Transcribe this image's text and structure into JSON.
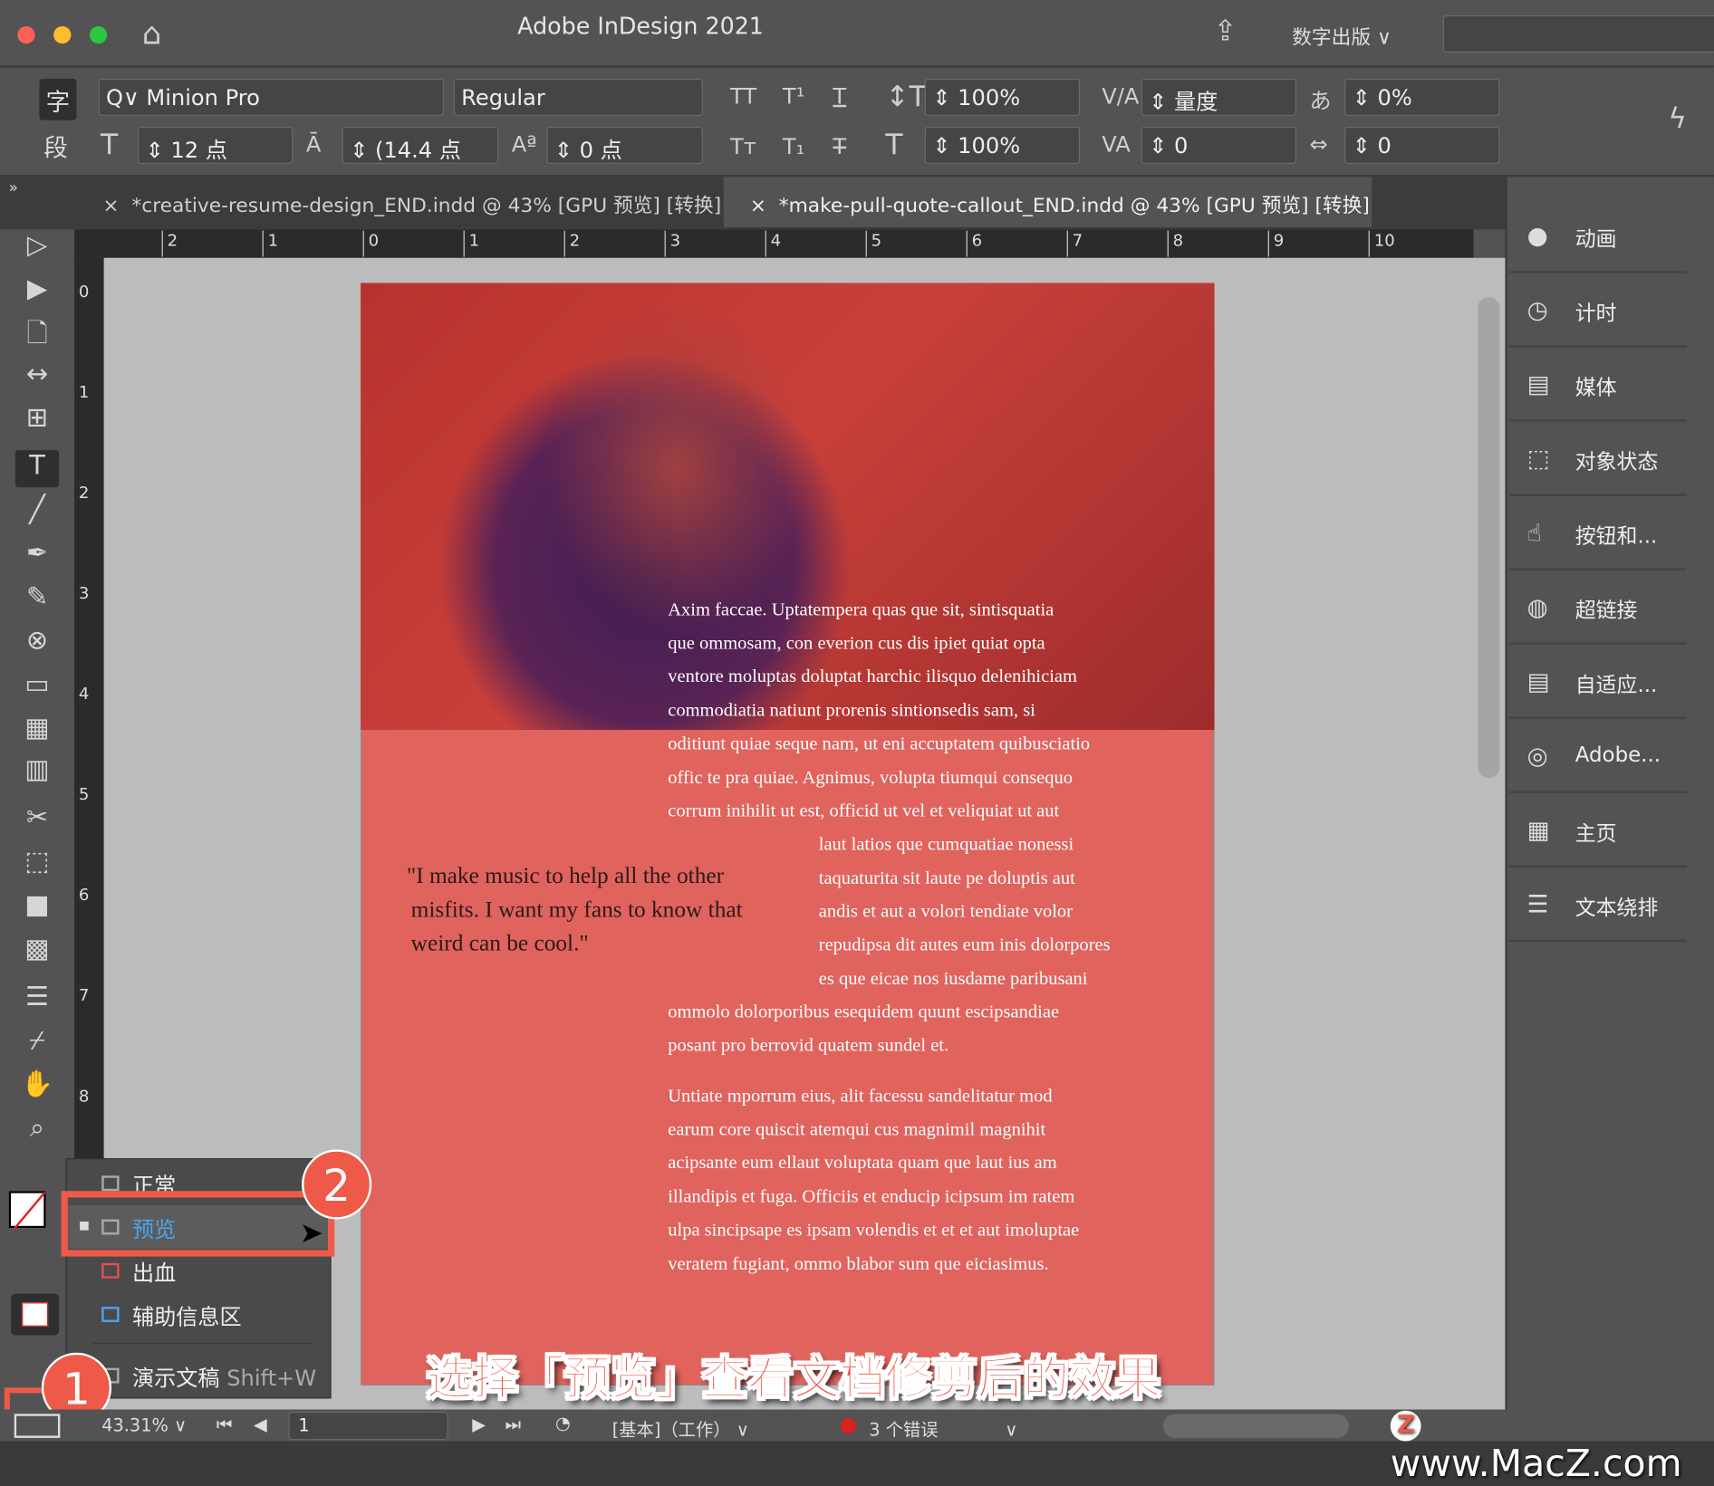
{
  "app": {
    "title": "Adobe InDesign 2021",
    "workspace": "数字出版"
  },
  "control": {
    "char_label": "字",
    "para_label": "段",
    "font": "Minion Pro",
    "style": "Regular",
    "size": "12 点",
    "leading": "(14.4 点",
    "baseline": "0 点",
    "vscale": "100%",
    "hscale": "100%",
    "kerning": "量度",
    "tracking": "0",
    "tsume": "0%",
    "grid": "0"
  },
  "tabs": [
    {
      "label": "*creative-resume-design_END.indd @ 43% [GPU 预览] [转换]",
      "active": false
    },
    {
      "label": "*make-pull-quote-callout_END.indd @ 43% [GPU 预览] [转换]",
      "active": true
    }
  ],
  "ruler": {
    "h": [
      "2",
      "1",
      "0",
      "1",
      "2",
      "3",
      "4",
      "5",
      "6",
      "7",
      "8",
      "9",
      "10"
    ],
    "v": [
      "0",
      "1",
      "2",
      "3",
      "4",
      "5",
      "6",
      "7",
      "8"
    ]
  },
  "document": {
    "body1": [
      "Axim faccae. Uptatempera quas que sit, sintisquatia",
      "que ommosam, con everion cus dis ipiet quiat opta",
      "ventore moluptas doluptat harchic ilisquo delenihiciam",
      "commodiatia natiunt prorenis sintionsedis sam, si",
      "oditiunt quiae seque nam, ut eni accuptatem quibusciatio",
      "offic te pra quiae. Agnimus, volupta tiumqui consequo",
      "corrum inihilit ut est, officid ut vel et veliquiat ut aut"
    ],
    "body2": [
      "laut latios que cumquatiae nonessi",
      "taquaturita sit laute pe doluptis aut",
      "andis et aut a volori tendiate volor",
      "repudipsa dit autes eum inis dolorpores",
      "es que eicae nos iusdame paribusani"
    ],
    "body3": [
      "ommolo dolorporibus esequidem quunt escipsandiae",
      "posant pro berrovid quatem sundel et."
    ],
    "body4": [
      "Untiate mporrum eius, alit facessu sandelitatur mod",
      "earum core quiscit atemqui cus magnimil magnihit",
      "acipsante eum ellaut voluptata quam que laut ius am",
      "illandipis et fuga. Officiis et enducip icipsum im ratem",
      "ulpa sincipsape es ipsam volendis et et et aut imoluptae",
      "veratem fugiant, ommo blabor sum que eiciasimus."
    ],
    "quote": [
      "\"I make music to help all the other",
      "misfits. I want my fans to know that",
      "weird can be cool.\""
    ]
  },
  "panels": [
    {
      "label": "动画",
      "icon": "animation-icon"
    },
    {
      "label": "计时",
      "icon": "timer-icon"
    },
    {
      "label": "媒体",
      "icon": "media-icon"
    },
    {
      "label": "对象状态",
      "icon": "object-states-icon"
    },
    {
      "label": "按钮和...",
      "icon": "buttons-icon"
    },
    {
      "label": "超链接",
      "icon": "hyperlinks-icon"
    },
    {
      "label": "自适应...",
      "icon": "liquid-layout-icon"
    },
    {
      "label": "Adobe...",
      "icon": "adobe-icon"
    },
    {
      "label": "主页",
      "icon": "pages-icon"
    },
    {
      "label": "文本绕排",
      "icon": "text-wrap-icon"
    }
  ],
  "view_menu": {
    "items": [
      {
        "label": "正常"
      },
      {
        "label": "预览",
        "selected": true
      },
      {
        "label": "出血"
      },
      {
        "label": "辅助信息区"
      },
      {
        "label": "演示文稿",
        "shortcut": "Shift+W"
      }
    ]
  },
  "badges": {
    "one": "1",
    "two": "2"
  },
  "status": {
    "zoom": "43.31%",
    "page": "1",
    "profile": "[基本]（工作）",
    "errors": "3 个错误"
  },
  "caption": "选择「预览」查看文档修剪后的效果",
  "watermark": "www.MacZ.com",
  "colors": {
    "page": "#e0635e",
    "highlight": "#ee5a47",
    "accent": "#4aa3f0",
    "error": "#e02020"
  }
}
